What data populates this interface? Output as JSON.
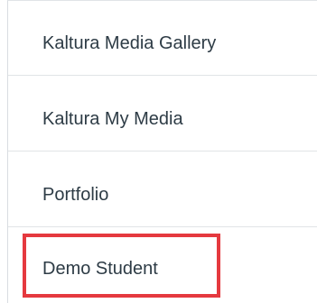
{
  "menu": {
    "items": [
      {
        "label": "Kaltura Media Gallery"
      },
      {
        "label": "Kaltura My Media"
      },
      {
        "label": "Portfolio"
      },
      {
        "label": "Demo Student"
      }
    ],
    "highlighted_index": 3,
    "highlight_color": "#e5393f",
    "text_color": "#2d3b45",
    "divider_color": "#e1e4e7"
  }
}
